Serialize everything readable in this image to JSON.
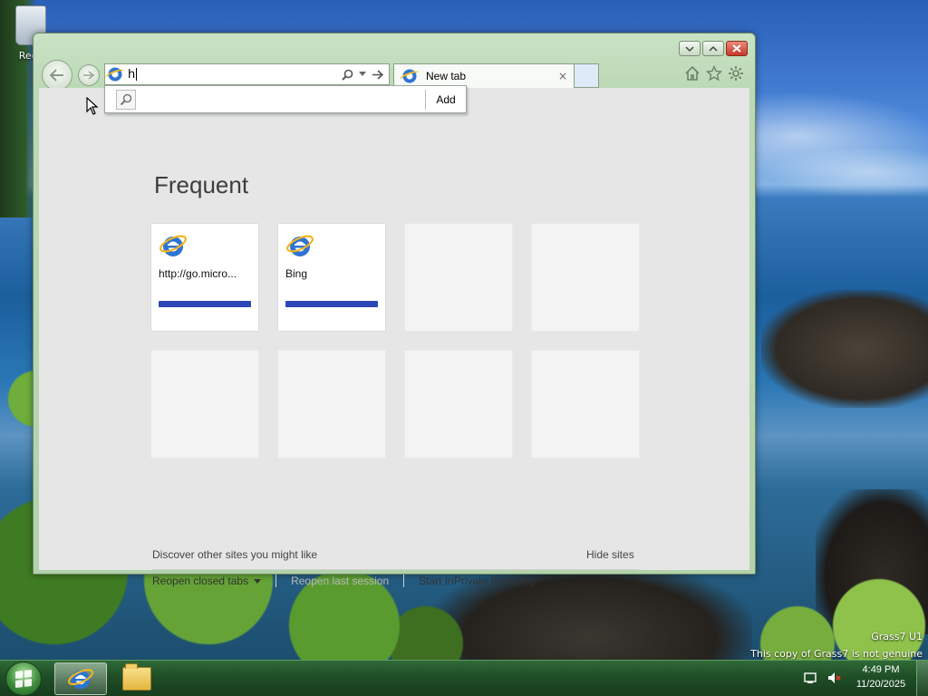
{
  "desktop": {
    "icons": [
      {
        "label": "Recy",
        "icon": "recycle-bin-icon"
      }
    ],
    "watermark": {
      "line1": "Grass7 U1",
      "line2": "This copy of Grass7 is not genuine"
    }
  },
  "browser": {
    "address": {
      "value": "h",
      "search_icon": "magnifier-icon",
      "dropdown_icon": "chevron-down-icon",
      "go_icon": "arrow-right-icon"
    },
    "tab": {
      "title": "New tab",
      "close_glyph": "×"
    },
    "suggestion": {
      "add_label": "Add"
    },
    "toolbar": {
      "home_icon": "home-icon",
      "favorites_icon": "star-icon",
      "tools_icon": "gear-icon"
    },
    "newtab_page": {
      "heading": "Frequent",
      "tiles": [
        {
          "label": "http://go.micro...",
          "icon": "ie-icon",
          "filled": true,
          "bar_fraction": 1.0
        },
        {
          "label": "Bing",
          "icon": "ie-icon",
          "filled": true,
          "bar_fraction": 1.0
        },
        {
          "label": "",
          "filled": false
        },
        {
          "label": "",
          "filled": false
        },
        {
          "label": "",
          "filled": false
        },
        {
          "label": "",
          "filled": false
        },
        {
          "label": "",
          "filled": false
        },
        {
          "label": "",
          "filled": false
        }
      ],
      "discover_label": "Discover other sites you might like",
      "hide_sites_label": "Hide sites",
      "reopen_closed_tabs_label": "Reopen closed tabs",
      "reopen_last_session_label": "Reopen last session",
      "inprivate_label": "Start InPrivate Browsing"
    },
    "colors": {
      "tile_bar": "#2d47b8",
      "frame": "#bcd9b6"
    }
  },
  "taskbar": {
    "clock_time": "4:49 PM",
    "clock_date": "11/20/2025",
    "apps": [
      {
        "name": "internet-explorer",
        "icon": "ie-icon",
        "active": true
      },
      {
        "name": "file-explorer",
        "icon": "folder-icon",
        "active": false
      }
    ],
    "tray_icons": [
      "action-center-icon",
      "volume-muted-icon"
    ]
  }
}
